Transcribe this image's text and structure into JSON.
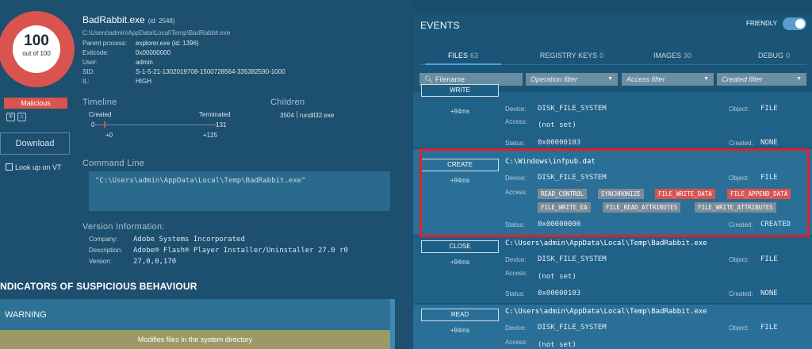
{
  "process": {
    "score": "100",
    "score_sub": "out of 100",
    "verdict": "Malicious",
    "name": "BadRabbit.exe",
    "pid": "(id: 2548)",
    "path": "C:\\Users\\admin\\AppData\\Local\\Temp\\BadRabbit.exe",
    "details": [
      {
        "k": "Parent process:",
        "v": "explorer.exe (id: 1396)"
      },
      {
        "k": "Exitcode:",
        "v": "0x00000000"
      },
      {
        "k": "User:",
        "v": "admin"
      },
      {
        "k": "SID:",
        "v": "S-1-5-21-1302019708-1500728564-335382590-1000"
      },
      {
        "k": "IL:",
        "v": "HIGH"
      }
    ],
    "download_label": "Download",
    "lookup_label": "Look up on VT"
  },
  "timeline": {
    "title": "Timeline",
    "created": "Created",
    "terminated": "Terminated",
    "start": "0",
    "end": "131",
    "created_offset": "+0",
    "terminated_offset": "+125"
  },
  "children": {
    "title": "Children",
    "pid": "3504",
    "name": "rundll32.exe"
  },
  "command_line": {
    "title": "Command Line",
    "value": "\"C:\\Users\\admin\\AppData\\Local\\Temp\\BadRabbit.exe\""
  },
  "version": {
    "title": "Version Information:",
    "rows": [
      {
        "k": "Company:",
        "v": "Adobe Systems Incorporated"
      },
      {
        "k": "Description:",
        "v": "Adobe® Flash® Player Installer/Uninstaller 27.0 r0"
      },
      {
        "k": "Version:",
        "v": "27,0,0,170"
      }
    ]
  },
  "indicators": {
    "title": "NDICATORS OF SUSPICIOUS BEHAVIOUR",
    "warning": "WARNING",
    "row": "Modifies files in the system directory"
  },
  "events": {
    "title": "EVENTS",
    "friendly_label": "FRIENDLY",
    "tabs": [
      {
        "label": "FILES",
        "count": "63"
      },
      {
        "label": "REGISTRY KEYS",
        "count": "0"
      },
      {
        "label": "IMAGES",
        "count": "30"
      },
      {
        "label": "DEBUG",
        "count": "0"
      }
    ],
    "filters": {
      "search_placeholder": "Filename",
      "operation": "Operation filter",
      "access": "Access filter",
      "created": "Created filter"
    },
    "labels": {
      "device": "Device:",
      "access": "Access:",
      "status": "Status:",
      "object": "Object:",
      "created": "Created:"
    },
    "items": [
      {
        "op": "WRITE",
        "ms": "+94ms",
        "device": "DISK_FILE_SYSTEM",
        "object": "FILE",
        "access": "(not set)",
        "status": "0x00000103",
        "created": "NONE"
      },
      {
        "op": "CREATE",
        "ms": "+94ms",
        "path": "C:\\Windows\\infpub.dat",
        "device": "DISK_FILE_SYSTEM",
        "object": "FILE",
        "access_flags": [
          "READ_CONTROL",
          "SYNCHRONIZE",
          "FILE_WRITE_DATA",
          "FILE_APPEND_DATA",
          "FILE_WRITE_EA",
          "FILE_READ_ATTRIBUTES",
          "FILE_WRITE_ATTRIBUTES"
        ],
        "status": "0x00000000",
        "created": "CREATED"
      },
      {
        "op": "CLOSE",
        "ms": "+94ms",
        "path": "C:\\Users\\admin\\AppData\\Local\\Temp\\BadRabbit.exe",
        "device": "DISK_FILE_SYSTEM",
        "object": "FILE",
        "access": "(not set)",
        "status": "0x00000103",
        "created": "NONE"
      },
      {
        "op": "READ",
        "ms": "+94ms",
        "path": "C:\\Users\\admin\\AppData\\Local\\Temp\\BadRabbit.exe",
        "device": "DISK_FILE_SYSTEM",
        "object": "FILE",
        "access": "(not set)"
      }
    ]
  },
  "colors": {
    "malicious": "#d9534f",
    "highlight": "#e0202a",
    "accent": "#4aa3df"
  }
}
